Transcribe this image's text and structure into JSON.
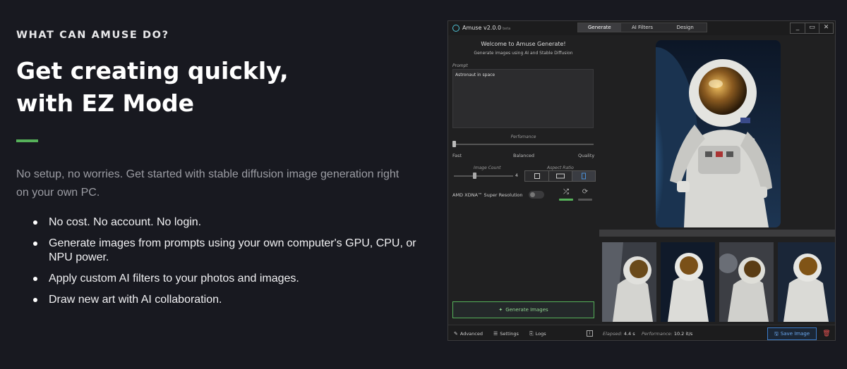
{
  "marketing": {
    "eyebrow": "WHAT CAN AMUSE DO?",
    "headline_line1": "Get creating quickly,",
    "headline_line2": "with EZ Mode",
    "description": "No setup, no worries. Get started with stable diffusion image generation right on your own PC.",
    "bullets": [
      "No cost. No account. No login.",
      "Generate images from prompts using your own computer's GPU, CPU, or NPU power.",
      "Apply custom AI filters to your photos and images.",
      "Draw new art with AI collaboration."
    ]
  },
  "app": {
    "title": "Amuse v2.0.0",
    "beta_tag": "beta",
    "tabs": [
      "Generate",
      "AI Filters",
      "Design"
    ],
    "active_tab": "Generate",
    "welcome_title": "Welcome to Amuse Generate!",
    "welcome_subtitle": "Generate images using AI and Stable Diffusion",
    "prompt_label": "Prompt",
    "prompt_value": "Astronaut in space",
    "performance_label": "Perfomance",
    "performance_options": [
      "Fast",
      "Balanced",
      "Quality"
    ],
    "performance_value": "Fast",
    "image_count_label": "Image Count",
    "image_count_value": "4",
    "aspect_ratio_label": "Aspect Ratio",
    "aspect_ratio_selected": "portrait",
    "super_resolution_label": "AMD XDNA™ Super Resolution",
    "super_resolution_enabled": false,
    "generate_button": "Generate Images",
    "bottom": {
      "advanced": "Advanced",
      "settings": "Settings",
      "logs": "Logs",
      "elapsed_label": "Elapsed:",
      "elapsed_value": "4.4 s",
      "performance_label": "Performance:",
      "performance_value": "10.2 it/s",
      "save_button": "Save Image"
    }
  },
  "colors": {
    "page_bg": "#181920",
    "accent_green": "#56b15a",
    "save_blue": "#3b7bc8",
    "delete_red": "#e05050"
  }
}
